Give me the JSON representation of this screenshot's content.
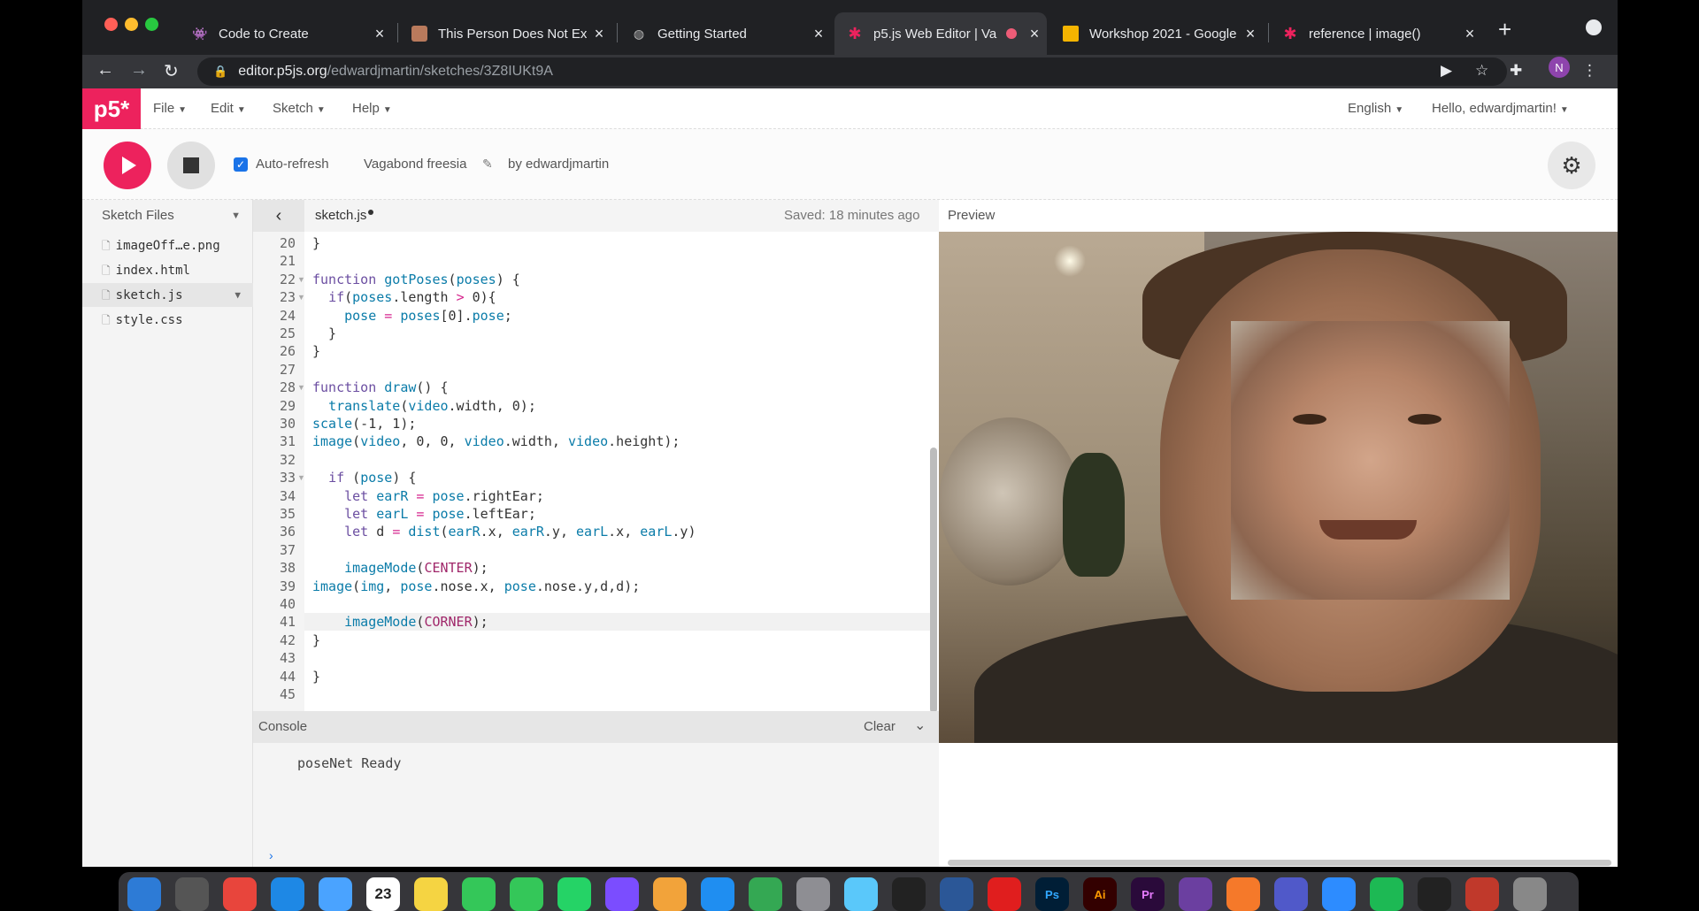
{
  "browser": {
    "tabs": [
      {
        "title": "Code to Create",
        "favicon": "space-invader-icon"
      },
      {
        "title": "This Person Does Not Ex",
        "favicon": "portrait-icon"
      },
      {
        "title": "Getting Started",
        "favicon": "globe-icon"
      },
      {
        "title": "p5.js Web Editor | Va",
        "favicon": "p5-star-icon",
        "active": true
      },
      {
        "title": "Workshop 2021 - Google",
        "favicon": "slides-icon"
      },
      {
        "title": "reference | image()",
        "favicon": "p5-star-icon"
      }
    ],
    "new_tab": "+",
    "address": {
      "host": "editor.p5js.org",
      "path": "/edwardjmartin/sketches/3Z8IUKt9A"
    },
    "profile_initial": "N"
  },
  "p5": {
    "logo": "p5*",
    "menus": [
      "File",
      "Edit",
      "Sketch",
      "Help"
    ],
    "language": "English",
    "greeting": "Hello, edwardjmartin!",
    "toolbar": {
      "auto_refresh_label": "Auto-refresh",
      "auto_refresh_checked": true,
      "sketch_name": "Vagabond freesia",
      "byline": "by edwardjmartin"
    },
    "sidebar": {
      "title": "Sketch Files",
      "files": [
        {
          "name": "imageOff…e.png"
        },
        {
          "name": "index.html"
        },
        {
          "name": "sketch.js",
          "selected": true
        },
        {
          "name": "style.css"
        }
      ]
    },
    "editor": {
      "file_tab": "sketch.js",
      "saved": "Saved: 18 minutes ago",
      "line_numbers": [
        "20",
        "21",
        "22",
        "23",
        "24",
        "25",
        "26",
        "27",
        "28",
        "29",
        "30",
        "31",
        "32",
        "33",
        "34",
        "35",
        "36",
        "37",
        "38",
        "39",
        "40",
        "41",
        "42",
        "43",
        "44",
        "45"
      ],
      "code_lines": [
        "}",
        "",
        "function gotPoses(poses) {",
        "  if(poses.length > 0){",
        "    pose = poses[0].pose;",
        "  }",
        "}",
        "",
        "function draw() {",
        "  translate(video.width, 0);",
        "scale(-1, 1);",
        "image(video, 0, 0, video.width, video.height);",
        "",
        "  if (pose) {",
        "    let earR = pose.rightEar;",
        "    let earL = pose.leftEar;",
        "    let d = dist(earR.x, earR.y, earL.x, earL.y)",
        "",
        "    imageMode(CENTER);",
        "image(img, pose.nose.x, pose.nose.y,d,d);",
        "",
        "    imageMode(CORNER);",
        "}",
        "",
        "}",
        ""
      ]
    },
    "console": {
      "title": "Console",
      "clear": "Clear",
      "messages": [
        "poseNet Ready"
      ],
      "prompt": "›"
    },
    "preview": {
      "title": "Preview"
    }
  },
  "dock": {
    "icons": [
      "finder-icon",
      "launchpad-icon",
      "chrome-icon",
      "safari-icon",
      "mail-icon",
      "calendar-icon",
      "notes-icon",
      "messages-icon",
      "facetime-icon",
      "whatsapp-icon",
      "messenger-icon",
      "pages-icon",
      "keynote-icon",
      "numbers-icon",
      "system-preferences-icon",
      "preview-icon",
      "audio-icon",
      "browser-icon",
      "acrobat-icon",
      "photoshop-icon",
      "illustrator-icon",
      "premiere-icon",
      "imovie-icon",
      "blender-icon",
      "teams-icon",
      "zoom-icon",
      "spotify-icon",
      "terminal-icon",
      "settings-icon",
      "trash-icon"
    ],
    "badges": {
      "calendar_day": "23",
      "calendar_month": "JUN",
      "ps": "Ps",
      "ai": "Ai",
      "pr": "Pr"
    }
  },
  "colors": {
    "p5_pink": "#ed225d",
    "chrome_dark": "#202124",
    "chrome_tab": "#35363a"
  }
}
